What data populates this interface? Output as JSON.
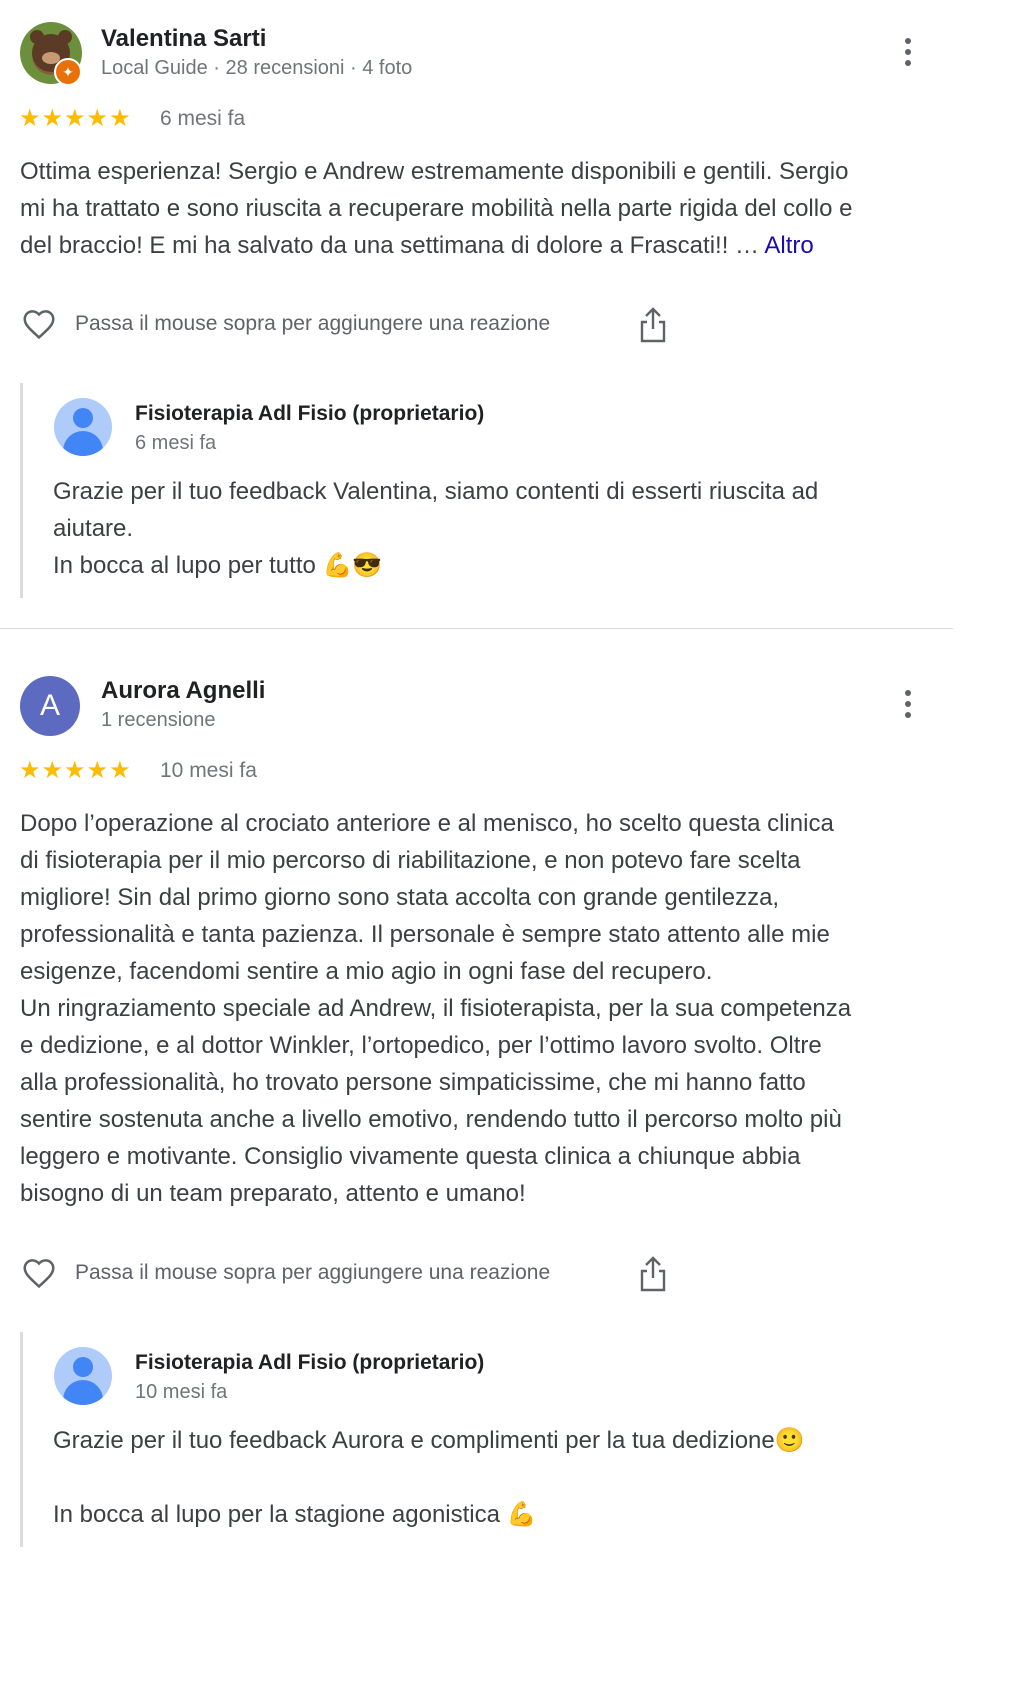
{
  "reviews": [
    {
      "author": "Valentina Sarti",
      "meta": "Local Guide · 28 recensioni · 4 foto",
      "stars": "★★★★★",
      "rating": 5,
      "time": "6 mesi fa",
      "text_lines": [
        "Ottima esperienza! Sergio e Andrew estremamente disponibili e gentili. Sergio",
        "mi ha trattato e sono riuscita a recuperare mobilità nella parte rigida del collo e",
        "del braccio! E mi ha salvato da una settimana di dolore a Frascati!! … "
      ],
      "more_label": "Altro",
      "reaction_label": "Passa il mouse sopra per aggiungere una reazione",
      "owner": {
        "name": "Fisioterapia Adl Fisio (proprietario)",
        "time": "6 mesi fa",
        "lines": [
          "Grazie per il tuo feedback Valentina, siamo contenti di esserti riuscita ad",
          "aiutare.",
          "In bocca al lupo per tutto 💪😎"
        ]
      }
    },
    {
      "author": "Aurora Agnelli",
      "avatar_letter": "A",
      "meta": "1 recensione",
      "stars": "★★★★★",
      "rating": 5,
      "time": "10 mesi fa",
      "text_lines": [
        "Dopo l’operazione al crociato anteriore e al menisco, ho scelto questa clinica",
        "di fisioterapia per il mio percorso di riabilitazione, e non potevo fare scelta",
        "migliore! Sin dal primo giorno sono stata accolta con grande gentilezza,",
        "professionalità e tanta pazienza. Il personale è sempre stato attento alle mie",
        "esigenze, facendomi sentire a mio agio in ogni fase del recupero.",
        "Un ringraziamento speciale ad Andrew, il fisioterapista, per la sua competenza",
        "e dedizione, e al dottor Winkler, l’ortopedico, per l’ottimo lavoro svolto. Oltre",
        "alla professionalità, ho trovato persone simpaticissime, che mi hanno fatto",
        "sentire sostenuta anche a livello emotivo, rendendo tutto il percorso molto più",
        "leggero e motivante. Consiglio vivamente questa clinica a chiunque abbia",
        "bisogno di un team preparato, attento e umano!"
      ],
      "reaction_label": "Passa il mouse sopra per aggiungere una reazione",
      "owner": {
        "name": "Fisioterapia Adl Fisio (proprietario)",
        "time": "10 mesi fa",
        "lines": [
          "Grazie per il tuo feedback Aurora e complimenti per la tua dedizione🙂",
          "",
          "In bocca al lupo per la stagione agonistica 💪"
        ]
      }
    }
  ],
  "icons": {
    "heart": "heart-outline-icon",
    "share": "share-icon",
    "more": "more-vert-icon",
    "guide_badge": "local-guide-badge-icon"
  },
  "colors": {
    "star": "#fbbc04",
    "link": "#1a0dab",
    "avatar_letter_bg": "#5c6bc0",
    "owner_avatar": "#4285f4",
    "guide_badge": "#e8710a"
  }
}
